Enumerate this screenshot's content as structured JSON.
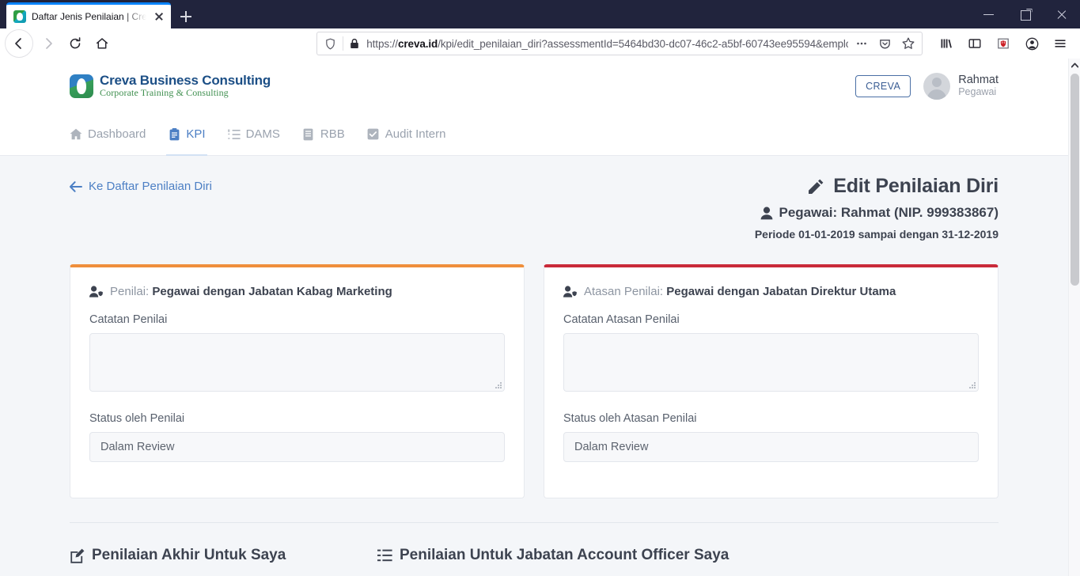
{
  "browser": {
    "tab": {
      "title": "Daftar Jenis Penilaian | Creva Bu",
      "favicon": "creva-favicon-icon",
      "close": "close-icon"
    },
    "new_tab": "+",
    "window_controls": {
      "minimize": "minimize-icon",
      "maximize": "restore-icon",
      "close": "close-icon"
    },
    "nav": {
      "back": "back-arrow-icon",
      "forward": "forward-arrow-icon",
      "reload": "reload-icon",
      "home": "home-icon"
    },
    "url": {
      "scheme": "https://",
      "domain": "creva.id",
      "path": "/kpi/edit_penilaian_diri?assessmentId=5464bd30-dc07-46c2-a5bf-60743ee95594&employ",
      "full": "https://creva.id/kpi/edit_penilaian_diri?assessmentId=5464bd30-dc07-46c2-a5bf-60743ee95594&employ",
      "shield": "tracking-protection-icon",
      "lock": "lock-icon"
    },
    "toolbar_right": [
      "page-actions-icon",
      "pocket-icon",
      "bookmark-star-icon",
      "library-icon",
      "sidebar-icon",
      "extension-shield-icon",
      "account-icon",
      "app-menu-icon"
    ]
  },
  "header": {
    "logo_main": "Creva Business Consulting",
    "logo_sub": "Corporate Training & Consulting",
    "creva_button": "CREVA",
    "user_name": "Rahmat",
    "user_role": "Pegawai"
  },
  "nav": {
    "items": [
      {
        "label": "Dashboard",
        "icon": "home-icon",
        "active": false
      },
      {
        "label": "KPI",
        "icon": "clipboard-icon",
        "active": true
      },
      {
        "label": "DAMS",
        "icon": "list-ol-icon",
        "active": false
      },
      {
        "label": "RBB",
        "icon": "book-icon",
        "active": false
      },
      {
        "label": "Audit Intern",
        "icon": "check-square-icon",
        "active": false
      }
    ]
  },
  "main": {
    "back_link": "Ke Daftar Penilaian Diri",
    "back_icon": "arrow-left-icon",
    "title": "Edit Penilaian Diri",
    "title_icon": "pencil-icon",
    "employee_line": "Pegawai: Rahmat (NIP. 999383867)",
    "employee_icon": "user-icon",
    "period_line": "Periode 01-01-2019 sampai dengan 31-12-2019",
    "cards": [
      {
        "accent": "#ef8f3c",
        "head_prefix": "Penilai:",
        "head_value": "Pegawai dengan Jabatan Kabag Marketing",
        "head_icon": "user-shield-icon",
        "note_label": "Catatan Penilai",
        "note_value": "",
        "note_placeholder": "",
        "status_label": "Status oleh Penilai",
        "status_value": "Dalam Review"
      },
      {
        "accent": "#c92a3a",
        "head_prefix": "Atasan Penilai:",
        "head_value": "Pegawai dengan Jabatan Direktur Utama",
        "head_icon": "user-shield-icon",
        "note_label": "Catatan Atasan Penilai",
        "note_value": "",
        "note_placeholder": "",
        "status_label": "Status oleh Atasan Penilai",
        "status_value": "Dalam Review"
      }
    ],
    "bottom_sections": [
      {
        "label": "Penilaian Akhir Untuk Saya",
        "icon": "edit-square-icon"
      },
      {
        "label": "Penilaian Untuk Jabatan Account Officer Saya",
        "icon": "list-icon"
      }
    ]
  }
}
